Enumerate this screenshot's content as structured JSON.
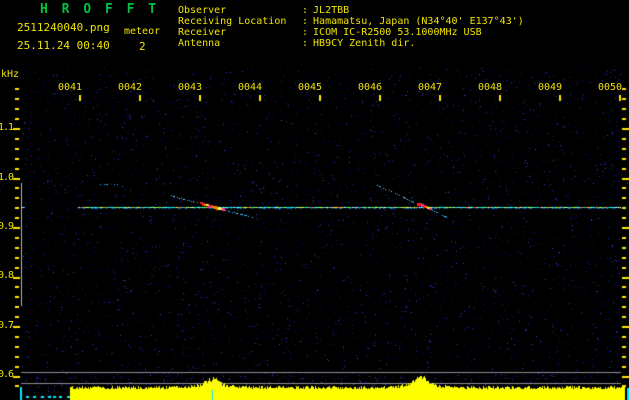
{
  "header": {
    "title": "H R O F F T",
    "filename": "2511240040.png",
    "mode": "meteor",
    "datetime": "25.11.24 00:40",
    "count": "2",
    "separator": ":",
    "info_rows": [
      {
        "label": "Observer",
        "value": "JL2TBB"
      },
      {
        "label": "Receiving Location",
        "value": "Hamamatsu, Japan (N34°40' E137°43')"
      },
      {
        "label": "Receiver",
        "value": "ICOM IC-R2500 53.1000MHz USB"
      },
      {
        "label": "Antenna",
        "value": "HB9CY Zenith dir."
      }
    ]
  },
  "colors": {
    "background": "#000000",
    "title_green": "#00c040",
    "axis_yellow": "#f0e400",
    "tick_yellow": "#ffe800",
    "noise_blue": "#2424a0",
    "carrier_cyan": "#00e0ff",
    "echo_red": "#ff2020",
    "signal_yellow": "#ffff00",
    "grid_gray": "#8c8c96",
    "cyan_marker": "#00e8ff"
  },
  "chart_data": [
    {
      "type": "heatmap",
      "name": "doppler-spectrogram",
      "title": "HROFFT 10-minute meteor echo spectrogram",
      "ylabel": "kHz",
      "x_ticks": [
        "0041",
        "0042",
        "0043",
        "0044",
        "0045",
        "0046",
        "0047",
        "0048",
        "0049",
        "0050"
      ],
      "y_ticks": [
        "1.1",
        "1.0",
        "0.9",
        "0.8",
        "0.7",
        "0.6"
      ],
      "x_range": [
        "0040",
        "0050"
      ],
      "y_range_khz": [
        0.58,
        1.18
      ],
      "grid": false,
      "carrier": {
        "freq_khz": 0.943,
        "start_time": "0040:58",
        "end_time": "0050:00"
      },
      "meteor_echoes": [
        {
          "time_start": "0041:20",
          "time_end": "0041:38",
          "freq_start_khz": 0.987,
          "freq_end_khz": 0.987,
          "peak": false
        },
        {
          "time_start": "0042:32",
          "time_end": "0043:52",
          "freq_start_khz": 0.965,
          "freq_end_khz": 0.921,
          "peak": true
        },
        {
          "time_start": "0045:56",
          "time_end": "0047:06",
          "freq_start_khz": 0.988,
          "freq_end_khz": 0.922,
          "peak": true
        }
      ],
      "noise": "sparse dark-blue background speckle"
    },
    {
      "type": "area",
      "name": "signal-level-strip",
      "color": "#ffff00",
      "start_time": "0040:50",
      "end_time": "0050:00",
      "baseline": "flat noise floor with small fluctuations",
      "peaks": [
        {
          "time": "0043:12"
        },
        {
          "time": "0046:40"
        }
      ]
    }
  ]
}
